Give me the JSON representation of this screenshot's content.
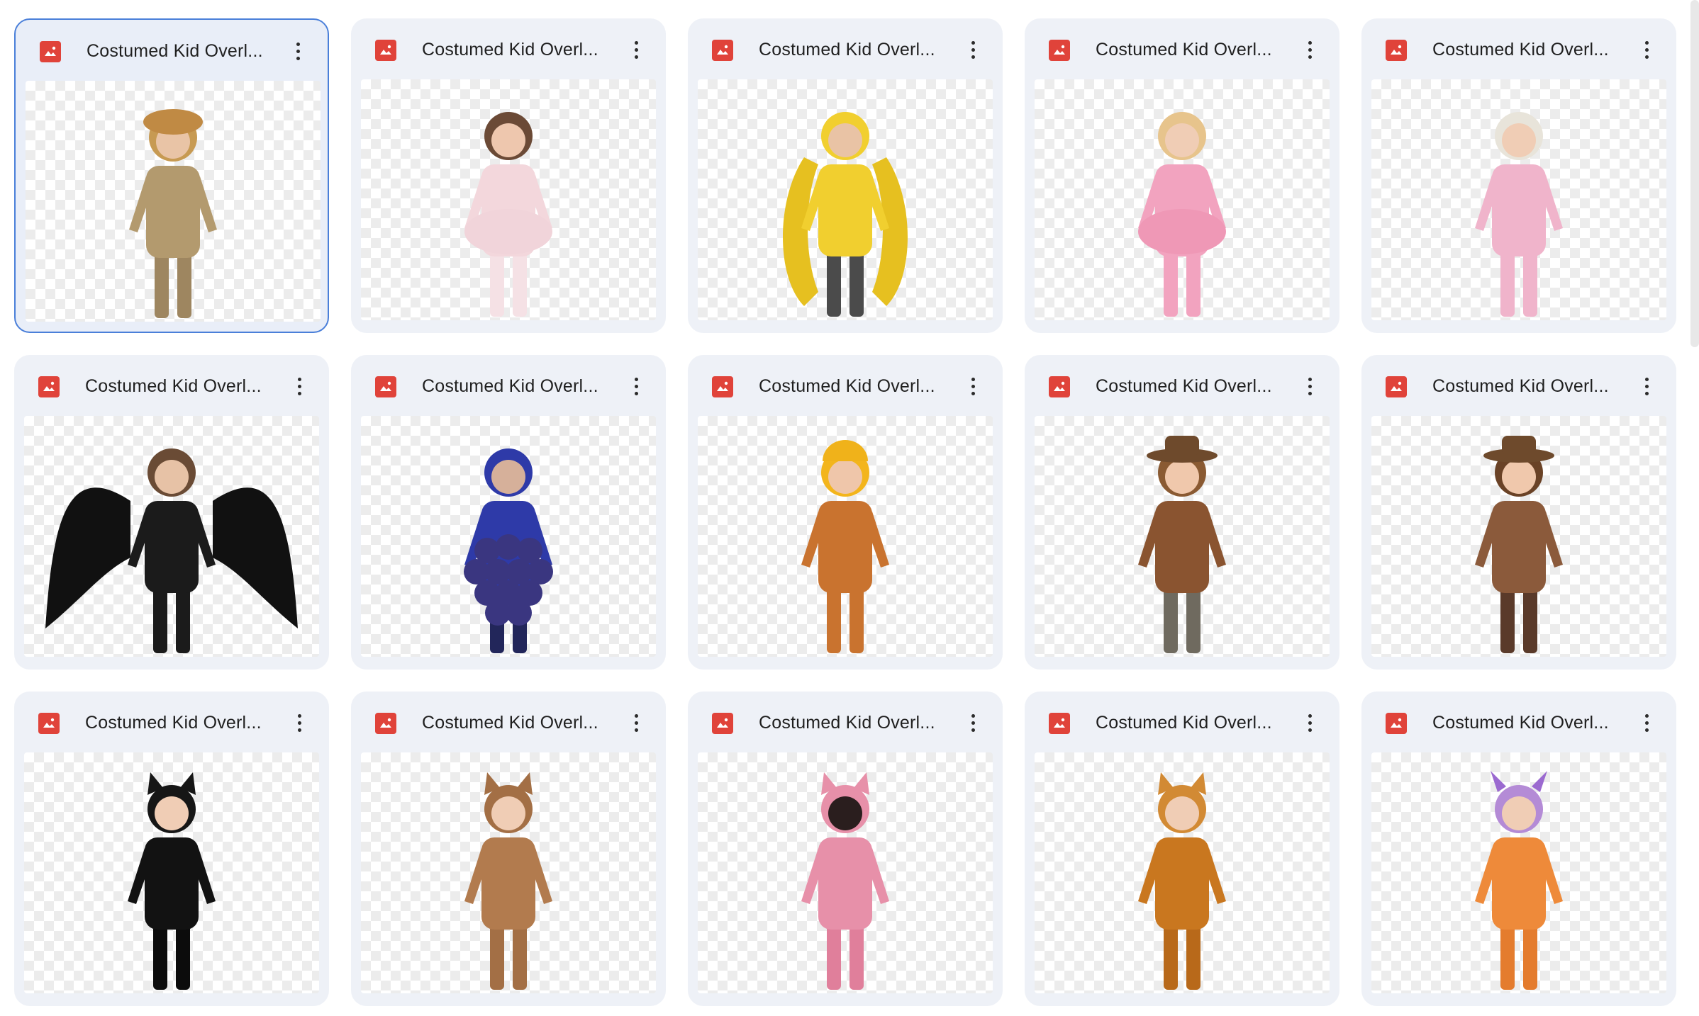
{
  "grid": {
    "files": [
      {
        "name": "Costumed Kid Overl...",
        "type_icon": "image-file-icon",
        "figure": "scarecrow",
        "selected": true
      },
      {
        "name": "Costumed Kid Overl...",
        "type_icon": "image-file-icon",
        "figure": "ballerina"
      },
      {
        "name": "Costumed Kid Overl...",
        "type_icon": "image-file-icon",
        "figure": "banana"
      },
      {
        "name": "Costumed Kid Overl...",
        "type_icon": "image-file-icon",
        "figure": "pink-dress"
      },
      {
        "name": "Costumed Kid Overl...",
        "type_icon": "image-file-icon",
        "figure": "pink-jumpsuit"
      },
      {
        "name": "Costumed Kid Overl...",
        "type_icon": "image-file-icon",
        "figure": "black-angel"
      },
      {
        "name": "Costumed Kid Overl...",
        "type_icon": "image-file-icon",
        "figure": "blueberry"
      },
      {
        "name": "Costumed Kid Overl...",
        "type_icon": "image-file-icon",
        "figure": "construction-worker"
      },
      {
        "name": "Costumed Kid Overl...",
        "type_icon": "image-file-icon",
        "figure": "cowboy"
      },
      {
        "name": "Costumed Kid Overl...",
        "type_icon": "image-file-icon",
        "figure": "cowgirl"
      },
      {
        "name": "Costumed Kid Overl...",
        "type_icon": "image-file-icon",
        "figure": "black-cat"
      },
      {
        "name": "Costumed Kid Overl...",
        "type_icon": "image-file-icon",
        "figure": "teddy-bear"
      },
      {
        "name": "Costumed Kid Overl...",
        "type_icon": "image-file-icon",
        "figure": "pink-monster"
      },
      {
        "name": "Costumed Kid Overl...",
        "type_icon": "image-file-icon",
        "figure": "orange-fox"
      },
      {
        "name": "Costumed Kid Overl...",
        "type_icon": "image-file-icon",
        "figure": "orange-monster"
      }
    ]
  },
  "colors": {
    "card_bg": "#eef1f7",
    "selected_border": "#4a7fd9",
    "file_icon_red": "#e0433a",
    "checker": "#ececec"
  }
}
